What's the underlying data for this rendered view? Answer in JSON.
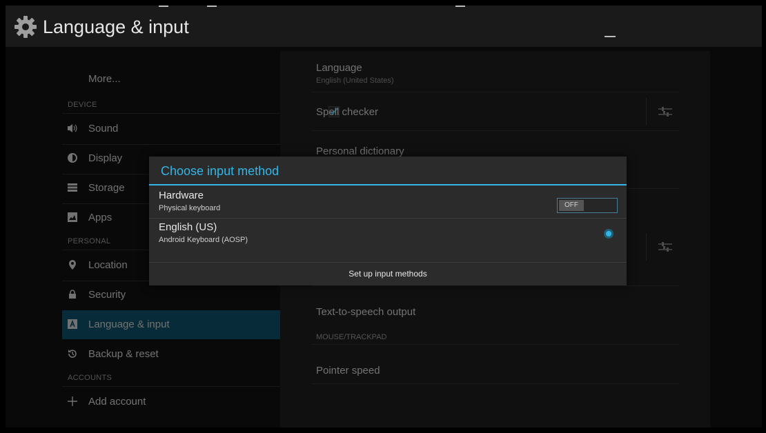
{
  "header": {
    "title": "Language & input",
    "icon": "settings-gear-icon"
  },
  "sidebar": {
    "more": "More...",
    "sections": {
      "device": "DEVICE",
      "personal": "PERSONAL",
      "accounts": "ACCOUNTS"
    },
    "items": [
      {
        "label": "Sound",
        "icon": "speaker-icon"
      },
      {
        "label": "Display",
        "icon": "brightness-icon"
      },
      {
        "label": "Storage",
        "icon": "storage-icon"
      },
      {
        "label": "Apps",
        "icon": "apps-icon"
      },
      {
        "label": "Location",
        "icon": "location-pin-icon"
      },
      {
        "label": "Security",
        "icon": "lock-icon"
      },
      {
        "label": "Language & input",
        "icon": "keyboard-letter-icon",
        "active": true
      },
      {
        "label": "Backup & reset",
        "icon": "restore-icon"
      },
      {
        "label": "Add account",
        "icon": "plus-icon"
      }
    ]
  },
  "settings": {
    "language_title": "Language",
    "language_value": "English (United States)",
    "spell_checker": "Spell checker",
    "personal_dictionary": "Personal dictionary",
    "tts_output": "Text-to-speech output",
    "mouse_header": "MOUSE/TRACKPAD",
    "pointer_speed": "Pointer speed"
  },
  "dialog": {
    "title": "Choose input method",
    "hardware_title": "Hardware",
    "hardware_sub": "Physical keyboard",
    "hardware_toggle": "OFF",
    "english_title": "English (US)",
    "english_sub": "Android Keyboard (AOSP)",
    "setup_button": "Set up input methods"
  },
  "colors": {
    "accent": "#33b5e5",
    "active_item": "#0d4f66",
    "background": "#121212"
  }
}
